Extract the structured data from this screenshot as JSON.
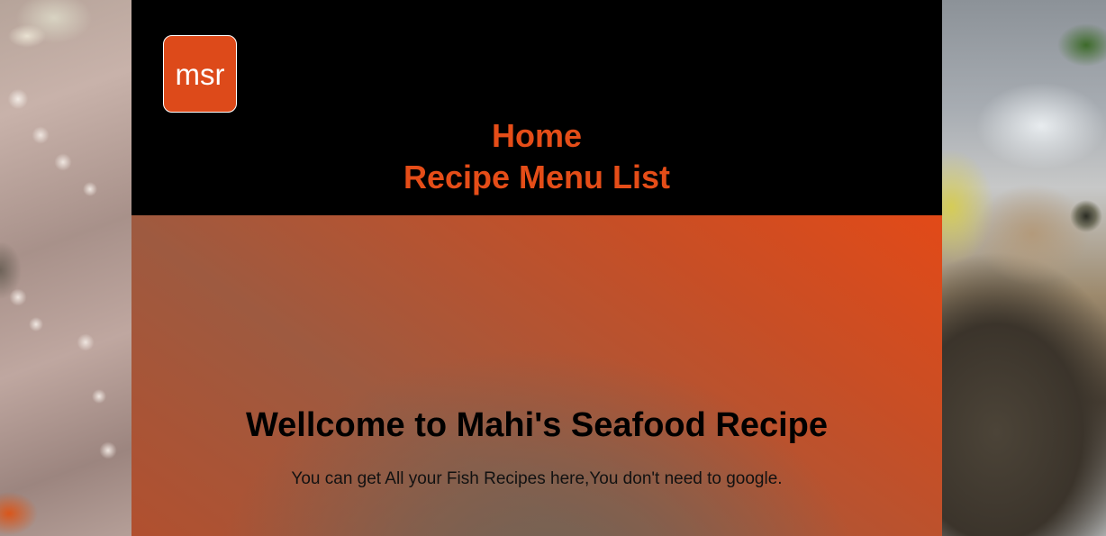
{
  "logo": {
    "text": "msr",
    "color": "#dd4a1a"
  },
  "nav": {
    "items": [
      {
        "label": "Home"
      },
      {
        "label": "Recipe Menu List"
      }
    ],
    "link_color": "#e54d18"
  },
  "hero": {
    "title": "Wellcome to Mahi's Seafood Recipe",
    "subtitle": "You can get All your Fish Recipes here,You don't need to google."
  },
  "colors": {
    "header_bg": "#000000",
    "accent": "#e24a18"
  }
}
